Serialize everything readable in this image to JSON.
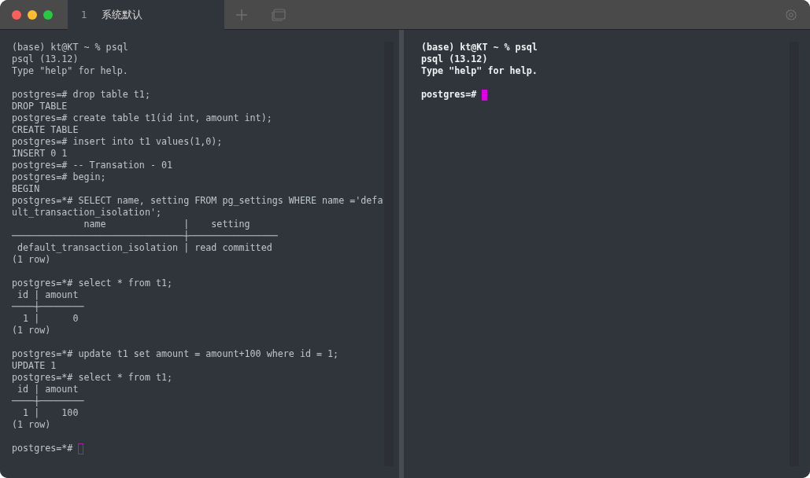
{
  "tab_bar": {
    "tabs": [
      {
        "number": "1",
        "title": "系统默认",
        "selected": true
      }
    ]
  },
  "panes": [
    {
      "active": false,
      "prompt": "postgres=*#",
      "blocks": [
        [
          "(base) kt@KT ~ % psql",
          "psql (13.12)",
          "Type \"help\" for help."
        ],
        [
          "postgres=# drop table t1;",
          "DROP TABLE",
          "postgres=# create table t1(id int, amount int);",
          "CREATE TABLE",
          "postgres=# insert into t1 values(1,0);",
          "INSERT 0 1",
          "postgres=# -- Transation - 01",
          "postgres=# begin;",
          "BEGIN",
          "postgres=*# SELECT name, setting FROM pg_settings WHERE name ='defa",
          "ult_transaction_isolation';",
          "             name              |    setting",
          "───────────────────────────────┼────────────────",
          " default_transaction_isolation | read committed",
          "(1 row)"
        ],
        [
          "postgres=*# select * from t1;",
          " id | amount",
          "────┼────────",
          "  1 |      0",
          "(1 row)"
        ],
        [
          "postgres=*# update t1 set amount = amount+100 where id = 1;",
          "UPDATE 1",
          "postgres=*# select * from t1;",
          " id | amount",
          "────┼────────",
          "  1 |    100",
          "(1 row)"
        ]
      ]
    },
    {
      "active": true,
      "prompt": "postgres=#",
      "blocks": [
        [
          "(base) kt@KT ~ % psql",
          "psql (13.12)",
          "Type \"help\" for help."
        ]
      ]
    }
  ]
}
